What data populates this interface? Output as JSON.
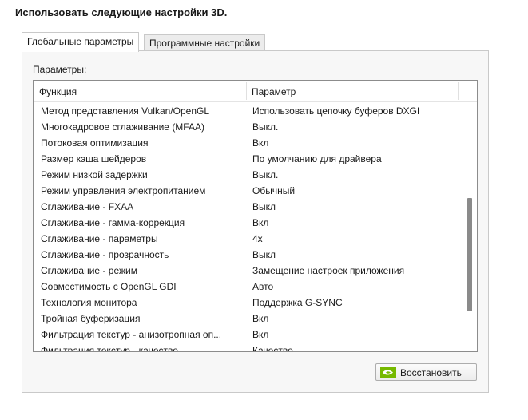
{
  "heading": "Использовать следующие настройки 3D.",
  "tabs": [
    {
      "label": "Глобальные параметры",
      "active": true
    },
    {
      "label": "Программные настройки",
      "active": false
    }
  ],
  "params_label": "Параметры:",
  "table": {
    "columns": [
      "Функция",
      "Параметр"
    ],
    "rows": [
      {
        "function": "Метод представления Vulkan/OpenGL",
        "value": "Использовать цепочку буферов DXGI"
      },
      {
        "function": "Многокадровое сглаживание (MFAA)",
        "value": "Выкл."
      },
      {
        "function": "Потоковая оптимизация",
        "value": "Вкл"
      },
      {
        "function": "Размер кэша шейдеров",
        "value": "По умолчанию для драйвера"
      },
      {
        "function": "Режим низкой задержки",
        "value": "Выкл."
      },
      {
        "function": "Режим управления электропитанием",
        "value": "Обычный"
      },
      {
        "function": "Сглаживание - FXAA",
        "value": "Выкл"
      },
      {
        "function": "Сглаживание - гамма-коррекция",
        "value": "Вкл"
      },
      {
        "function": "Сглаживание - параметры",
        "value": "4x"
      },
      {
        "function": "Сглаживание - прозрачность",
        "value": "Выкл"
      },
      {
        "function": "Сглаживание - режим",
        "value": "Замещение настроек приложения"
      },
      {
        "function": "Совместимость с OpenGL GDI",
        "value": "Авто"
      },
      {
        "function": "Технология монитора",
        "value": "Поддержка G-SYNC"
      },
      {
        "function": "Тройная буферизация",
        "value": "Вкл"
      },
      {
        "function": "Фильтрация текстур - анизотропная оп...",
        "value": "Вкл"
      },
      {
        "function": "Фильтрация текстур - качество",
        "value": "Качество"
      }
    ]
  },
  "restore_button": {
    "label": "Восстановить",
    "icon": "nvidia-logo-icon"
  },
  "colors": {
    "nvidia_green": "#76b900",
    "border": "#8c8c8c",
    "panel_bg": "#f7f7f7"
  }
}
